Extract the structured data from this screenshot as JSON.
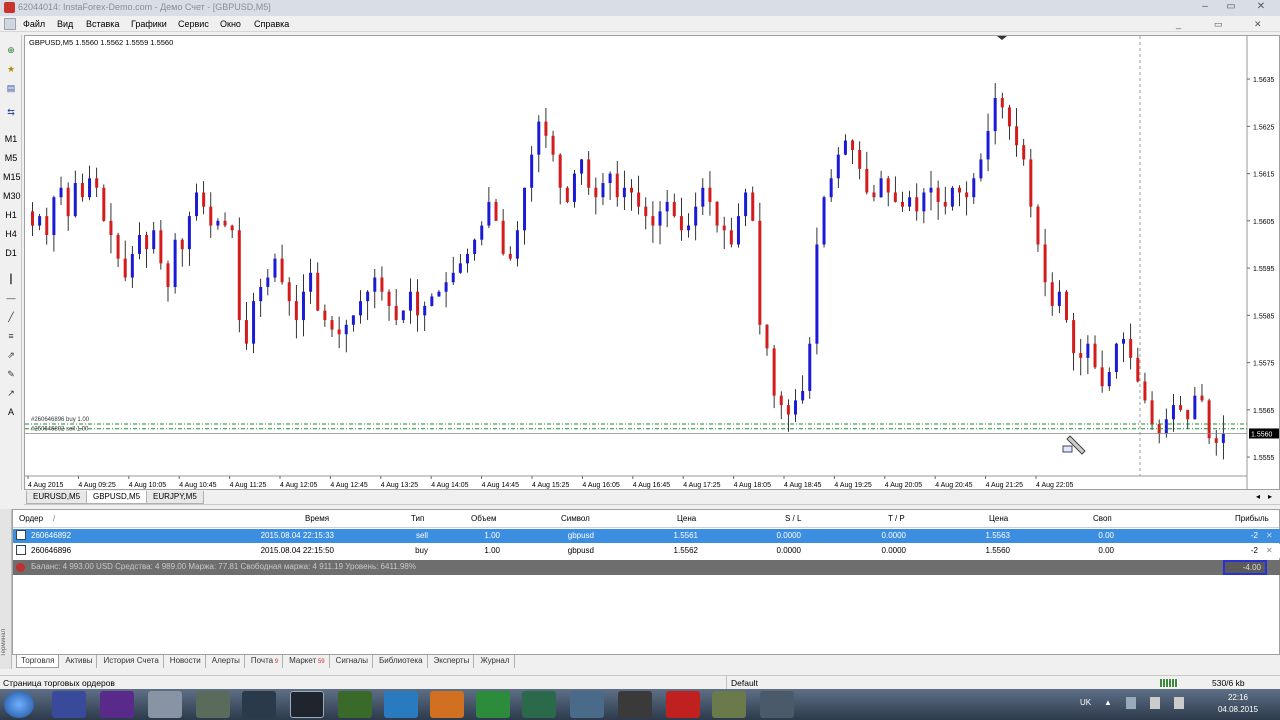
{
  "window": {
    "title": "62044014: InstaForex-Demo.com - Демо Счет - [GBPUSD,M5]",
    "min": "–",
    "max": "▭",
    "close": "✕"
  },
  "menu": [
    "Файл",
    "Вид",
    "Вставка",
    "Графики",
    "Сервис",
    "Окно",
    "Справка"
  ],
  "left_toolbar": {
    "timeframes": [
      "M1",
      "M5",
      "M15",
      "M30",
      "H1",
      "H4",
      "D1"
    ],
    "text_tool": "A"
  },
  "chart": {
    "label": "GBPUSD,M5 1.5560 1.5562 1.5559 1.5560",
    "order_label_buy": "#260646896 buy 1.00",
    "order_label_sell": "#260646892 sell 1.00",
    "price_axis": [
      "1.5635",
      "1.5625",
      "1.5615",
      "1.5605",
      "1.5595",
      "1.5585",
      "1.5575",
      "1.5565",
      "1.5555"
    ],
    "current_price": "1.5560",
    "time_axis": [
      "4 Aug 2015",
      "4 Aug 09:25",
      "4 Aug 10:05",
      "4 Aug 10:45",
      "4 Aug 11:25",
      "4 Aug 12:05",
      "4 Aug 12:45",
      "4 Aug 13:25",
      "4 Aug 14:05",
      "4 Aug 14:45",
      "4 Aug 15:25",
      "4 Aug 16:05",
      "4 Aug 16:45",
      "4 Aug 17:25",
      "4 Aug 18:05",
      "4 Aug 18:45",
      "4 Aug 19:25",
      "4 Aug 20:05",
      "4 Aug 20:45",
      "4 Aug 21:25",
      "4 Aug 22:05"
    ],
    "colors": {
      "bull": "#1b1bd6",
      "bear": "#d41c1c",
      "order_line": "#1f8a2a"
    }
  },
  "chart_data": {
    "type": "candlestick",
    "symbol": "GBPUSD",
    "timeframe": "M5",
    "ylim": [
      1.5551,
      1.5642
    ],
    "closes": [
      1.5604,
      1.5606,
      1.5602,
      1.561,
      1.5612,
      1.5606,
      1.5613,
      1.561,
      1.5614,
      1.5612,
      1.5605,
      1.5602,
      1.5597,
      1.5593,
      1.5598,
      1.5602,
      1.5599,
      1.5603,
      1.5596,
      1.5591,
      1.5601,
      1.5599,
      1.5606,
      1.5611,
      1.5608,
      1.5604,
      1.5605,
      1.5604,
      1.5603,
      1.5584,
      1.5579,
      1.5588,
      1.5591,
      1.5593,
      1.5597,
      1.5592,
      1.5588,
      1.5584,
      1.559,
      1.5594,
      1.5586,
      1.5584,
      1.5582,
      1.5581,
      1.5583,
      1.5585,
      1.5588,
      1.559,
      1.5593,
      1.559,
      1.5587,
      1.5584,
      1.5586,
      1.559,
      1.5585,
      1.5587,
      1.5589,
      1.559,
      1.5592,
      1.5594,
      1.5596,
      1.5598,
      1.5601,
      1.5604,
      1.5609,
      1.5605,
      1.5598,
      1.5597,
      1.5603,
      1.5612,
      1.5619,
      1.5626,
      1.5623,
      1.5619,
      1.5612,
      1.5609,
      1.5615,
      1.5618,
      1.5612,
      1.561,
      1.5613,
      1.5615,
      1.561,
      1.5612,
      1.5611,
      1.5608,
      1.5606,
      1.5604,
      1.5607,
      1.5609,
      1.5606,
      1.5603,
      1.5604,
      1.5608,
      1.5612,
      1.5609,
      1.5604,
      1.5603,
      1.56,
      1.5606,
      1.5611,
      1.5605,
      1.5583,
      1.5578,
      1.5568,
      1.5566,
      1.5564,
      1.5567,
      1.5569,
      1.5579,
      1.56,
      1.561,
      1.5614,
      1.5619,
      1.5622,
      1.562,
      1.5616,
      1.5611,
      1.561,
      1.5614,
      1.5611,
      1.5609,
      1.5608,
      1.561,
      1.5607,
      1.5611,
      1.5612,
      1.5609,
      1.5608,
      1.5612,
      1.5611,
      1.561,
      1.5614,
      1.5618,
      1.5624,
      1.5631,
      1.5629,
      1.5625,
      1.5621,
      1.5618,
      1.5608,
      1.56,
      1.5592,
      1.5587,
      1.559,
      1.5584,
      1.5577,
      1.5576,
      1.5579,
      1.5574,
      1.557,
      1.5573,
      1.5579,
      1.558,
      1.5576,
      1.5571,
      1.5567,
      1.5562,
      1.556,
      1.5563,
      1.5566,
      1.5565,
      1.5563,
      1.5568,
      1.5567,
      1.5559,
      1.5558,
      1.556
    ]
  },
  "chart_tabs": [
    "EURUSD,M5",
    "GBPUSD,M5",
    "EURJPY,M5"
  ],
  "terminal": {
    "headers": [
      "Ордер",
      "/",
      "Время",
      "Тип",
      "Объем",
      "Символ",
      "Цена",
      "S / L",
      "T / P",
      "Цена",
      "Своп",
      "Прибыль"
    ],
    "rows": [
      {
        "order": "260646892",
        "time": "2015.08.04 22:15:33",
        "type": "sell",
        "volume": "1.00",
        "symbol": "gbpusd",
        "price": "1.5561",
        "sl": "0.0000",
        "tp": "0.0000",
        "cur_price": "1.5563",
        "swap": "0.00",
        "profit": "-2"
      },
      {
        "order": "260646896",
        "time": "2015.08.04 22:15:50",
        "type": "buy",
        "volume": "1.00",
        "symbol": "gbpusd",
        "price": "1.5562",
        "sl": "0.0000",
        "tp": "0.0000",
        "cur_price": "1.5560",
        "swap": "0.00",
        "profit": "-2"
      }
    ],
    "balance_line": "Баланс: 4 993.00 USD  Средства: 4 989.00  Маржа: 77.81  Свободная маржа: 4 911.19  Уровень: 6411.98%",
    "balance_total": "-4.00",
    "strip_label": "Терминал"
  },
  "terminal_tabs": [
    {
      "label": "Торговля",
      "badge": ""
    },
    {
      "label": "Активы",
      "badge": ""
    },
    {
      "label": "История Счета",
      "badge": ""
    },
    {
      "label": "Новости",
      "badge": ""
    },
    {
      "label": "Алерты",
      "badge": ""
    },
    {
      "label": "Почта",
      "badge": "9"
    },
    {
      "label": "Маркет",
      "badge": "59"
    },
    {
      "label": "Сигналы",
      "badge": ""
    },
    {
      "label": "Библиотека",
      "badge": ""
    },
    {
      "label": "Эксперты",
      "badge": ""
    },
    {
      "label": "Журнал",
      "badge": ""
    }
  ],
  "status": {
    "left": "Страница торговых ордеров",
    "profile": "Default",
    "traffic": "530/6 kb"
  },
  "taskbar": {
    "lang": "UK",
    "time": "22:16",
    "date": "04.08.2015"
  }
}
